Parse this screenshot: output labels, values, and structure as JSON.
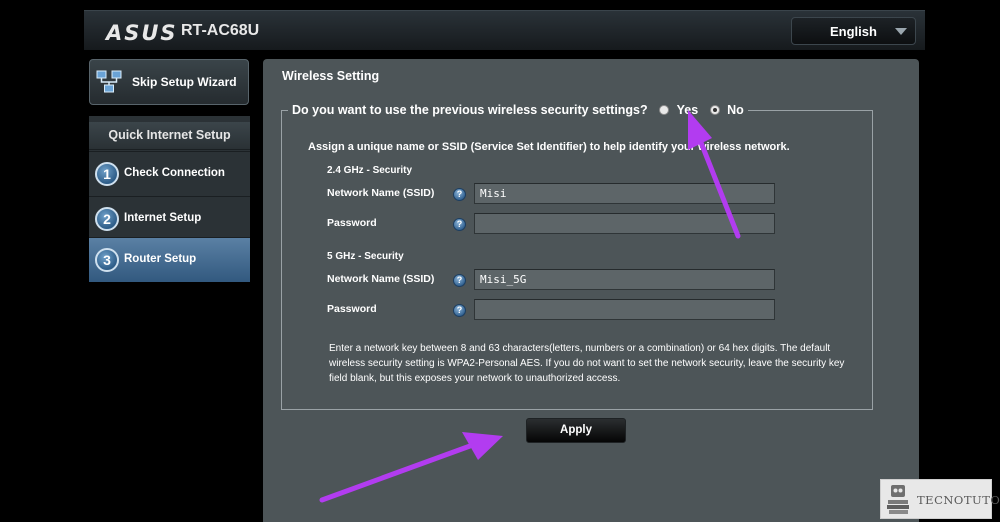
{
  "header": {
    "brand": "ASUS",
    "model": "RT-AC68U",
    "language": "English"
  },
  "sidebar": {
    "skip_button": "Skip Setup Wizard",
    "section_title": "Quick Internet Setup",
    "items": [
      {
        "num": "1",
        "label": "Check Connection",
        "active": false
      },
      {
        "num": "2",
        "label": "Internet Setup",
        "active": false
      },
      {
        "num": "3",
        "label": "Router Setup",
        "active": true
      }
    ]
  },
  "main": {
    "title": "Wireless Setting",
    "question": "Do you want to use the previous wireless security settings?",
    "option_yes": "Yes",
    "option_no": "No",
    "selected_option": "No",
    "intro": "Assign a unique name or SSID (Service Set Identifier) to help identify your wireless network.",
    "help_glyph": "?",
    "band_24": {
      "title": "2.4 GHz - Security",
      "ssid_label": "Network Name (SSID)",
      "ssid_value": "Misi",
      "password_label": "Password",
      "password_value": ""
    },
    "band_5": {
      "title": "5 GHz - Security",
      "ssid_label": "Network Name (SSID)",
      "ssid_value": "Misi_5G",
      "password_label": "Password",
      "password_value": ""
    },
    "note": "Enter a network key between 8 and 63 characters(letters, numbers or a combination) or 64 hex digits. The default wireless security setting is WPA2-Personal AES. If you do not want to set the network security, leave the security key field blank, but this exposes your network to unauthorized access.",
    "apply_button": "Apply"
  },
  "watermark": {
    "text": "TECNOTUTO"
  },
  "colors": {
    "panel_bg": "#4d5558",
    "active_nav": "#3f6890",
    "annotation_arrow": "#b23cf0"
  },
  "icons": {
    "skip": "network-nodes-icon",
    "help": "help-icon",
    "language": "chevron-down-icon",
    "watermark": "robot-books-icon"
  }
}
